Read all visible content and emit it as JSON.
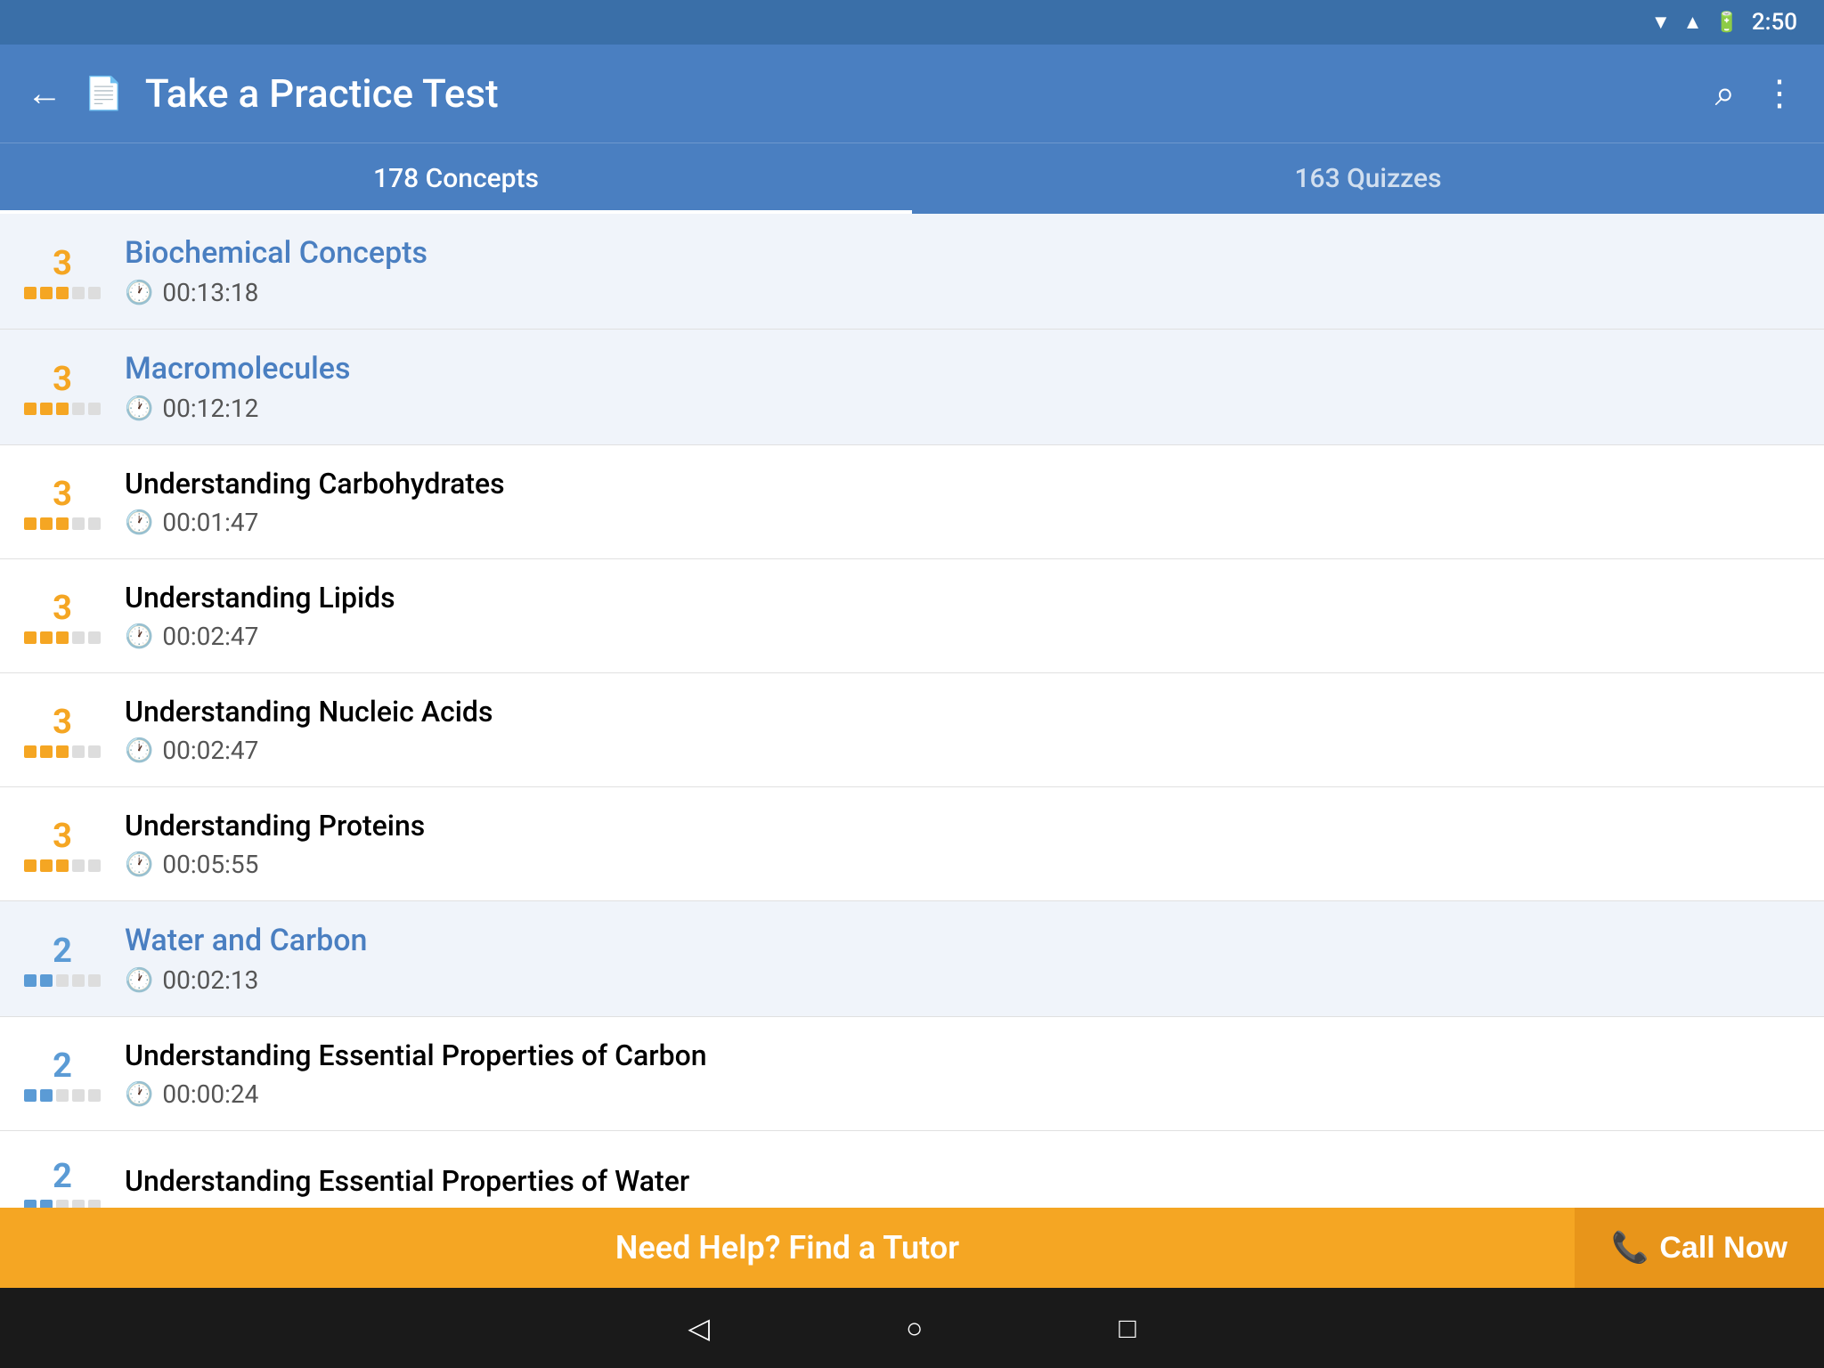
{
  "statusBar": {
    "time": "2:50",
    "icons": [
      "wifi",
      "signal",
      "battery"
    ]
  },
  "appBar": {
    "title": "Take a Practice Test",
    "backLabel": "←",
    "searchLabel": "⌕",
    "moreLabel": "⋮"
  },
  "tabs": [
    {
      "label": "178 Concepts",
      "active": true
    },
    {
      "label": "163 Quizzes",
      "active": false
    }
  ],
  "listItems": [
    {
      "type": "category",
      "title": "Biochemical Concepts",
      "time": "00:13:18",
      "score": "3",
      "scoreColor": "yellow",
      "dots": [
        "filled-yellow",
        "filled-yellow",
        "filled-yellow",
        "empty",
        "empty"
      ]
    },
    {
      "type": "category",
      "title": "Macromolecules",
      "time": "00:12:12",
      "score": "3",
      "scoreColor": "yellow",
      "dots": [
        "filled-yellow",
        "filled-yellow",
        "filled-yellow",
        "empty",
        "empty"
      ]
    },
    {
      "type": "item",
      "title": "Understanding Carbohydrates",
      "time": "00:01:47",
      "score": "3",
      "scoreColor": "yellow",
      "dots": [
        "filled-yellow",
        "filled-yellow",
        "filled-yellow",
        "empty",
        "empty"
      ]
    },
    {
      "type": "item",
      "title": "Understanding Lipids",
      "time": "00:02:47",
      "score": "3",
      "scoreColor": "yellow",
      "dots": [
        "filled-yellow",
        "filled-yellow",
        "filled-yellow",
        "empty",
        "empty"
      ]
    },
    {
      "type": "item",
      "title": "Understanding Nucleic Acids",
      "time": "00:02:47",
      "score": "3",
      "scoreColor": "yellow",
      "dots": [
        "filled-yellow",
        "filled-yellow",
        "filled-yellow",
        "empty",
        "empty"
      ]
    },
    {
      "type": "item",
      "title": "Understanding Proteins",
      "time": "00:05:55",
      "score": "3",
      "scoreColor": "yellow",
      "dots": [
        "filled-yellow",
        "filled-yellow",
        "filled-yellow",
        "empty",
        "empty"
      ]
    },
    {
      "type": "category",
      "title": "Water and Carbon",
      "time": "00:02:13",
      "score": "2",
      "scoreColor": "blue-light",
      "dots": [
        "filled-blue",
        "filled-blue",
        "empty",
        "empty",
        "empty"
      ]
    },
    {
      "type": "item",
      "title": "Understanding Essential Properties of Carbon",
      "time": "00:00:24",
      "score": "2",
      "scoreColor": "blue-light",
      "dots": [
        "filled-blue",
        "filled-blue",
        "empty",
        "empty",
        "empty"
      ]
    },
    {
      "type": "item",
      "title": "Understanding Essential Properties of Water",
      "time": "",
      "score": "2",
      "scoreColor": "blue-light",
      "dots": [
        "filled-blue",
        "filled-blue",
        "empty",
        "empty",
        "empty"
      ]
    }
  ],
  "banner": {
    "text": "Need Help? Find a Tutor",
    "callNow": "Call Now",
    "phoneIcon": "📞"
  },
  "navBar": {
    "back": "◁",
    "home": "○",
    "recent": "□"
  }
}
